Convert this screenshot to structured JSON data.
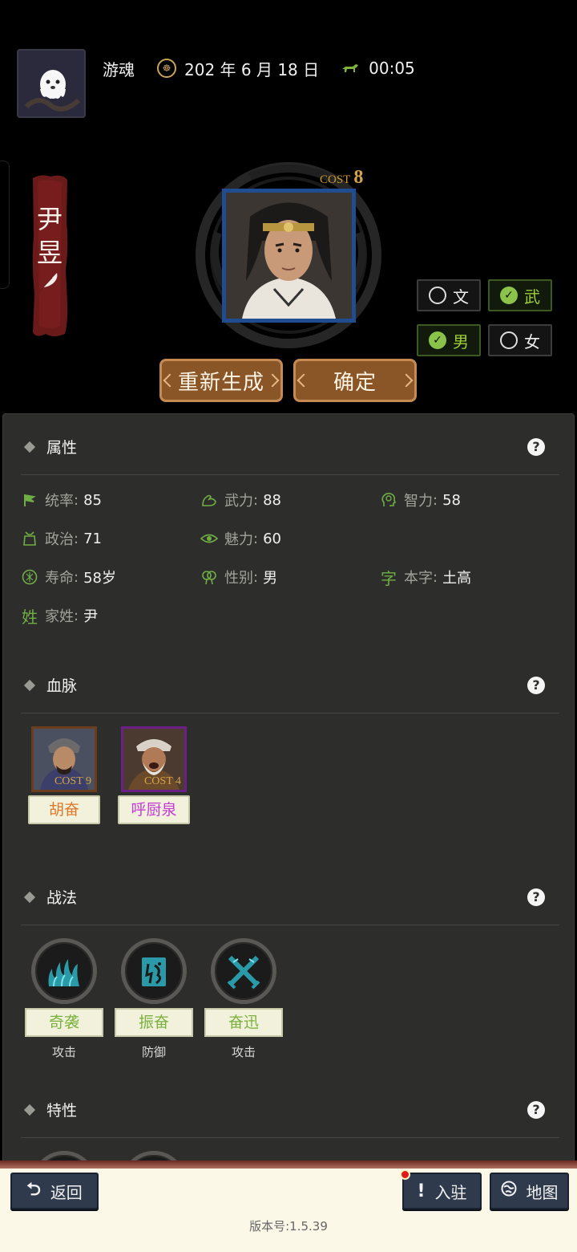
{
  "header": {
    "player_name": "游魂",
    "date": "202 年 6 月 18 日",
    "time": "00:05"
  },
  "general": {
    "name_line1": "尹",
    "name_line2": "昱",
    "cost_label": "COST",
    "cost_value": "8"
  },
  "options": {
    "civil": "文",
    "military": "武",
    "male": "男",
    "female": "女",
    "military_checked": true,
    "male_checked": true
  },
  "actions": {
    "regenerate": "重新生成",
    "confirm": "确定"
  },
  "attributes_section": {
    "title": "属性",
    "help": "?",
    "items": [
      {
        "label": "统率",
        "value": "85",
        "icon": "flag-icon"
      },
      {
        "label": "武力",
        "value": "88",
        "icon": "arm-icon"
      },
      {
        "label": "智力",
        "value": "58",
        "icon": "brain-icon"
      },
      {
        "label": "政治",
        "value": "71",
        "icon": "seal-icon"
      },
      {
        "label": "魅力",
        "value": "60",
        "icon": "eye-icon"
      },
      {
        "label": "寿命",
        "value": "58岁",
        "icon": "lifespan-icon"
      },
      {
        "label": "性别",
        "value": "男",
        "icon": "gender-icon"
      },
      {
        "label": "本字",
        "value": "土高",
        "icon": "char-zi-icon",
        "icon_text": "字"
      },
      {
        "label": "家姓",
        "value": "尹",
        "icon": "char-xing-icon",
        "icon_text": "姓"
      }
    ],
    "colon": ":"
  },
  "bloodline_section": {
    "title": "血脉",
    "help": "?",
    "items": [
      {
        "name": "胡奋",
        "cost": "9",
        "name_color": "#e0782a"
      },
      {
        "name": "呼厨泉",
        "cost": "4",
        "name_color": "#c43bd6"
      }
    ],
    "cost_label": "COST"
  },
  "tactics_section": {
    "title": "战法",
    "help": "?",
    "items": [
      {
        "name": "奇袭",
        "type": "攻击",
        "icon": "flames-icon"
      },
      {
        "name": "振奋",
        "type": "防御",
        "icon": "roar-icon"
      },
      {
        "name": "奋迅",
        "type": "攻击",
        "icon": "crossed-swords-icon"
      }
    ]
  },
  "traits_section": {
    "title": "特性",
    "help": "?"
  },
  "bottom_bar": {
    "back": "返回",
    "settle": "入驻",
    "map": "地图",
    "version": "版本号:1.5.39"
  },
  "colors": {
    "accent_green": "#8bc34a",
    "button_brown": "#8a5527",
    "portrait_border": "#1f4d8f",
    "nav_button": "#2f3a4c"
  }
}
